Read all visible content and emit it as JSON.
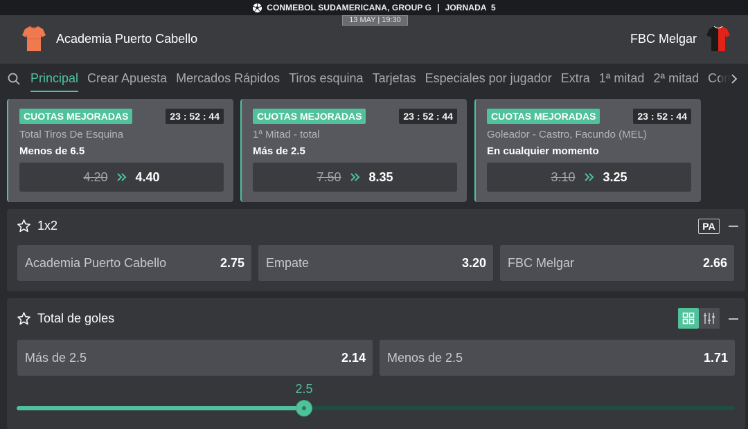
{
  "header": {
    "competition": "CONMEBOL SUDAMERICANA, GROUP G",
    "separator": "|",
    "round": "JORNADA  5",
    "date": "13 MAY | 19:30",
    "home_team": "Academia Puerto Cabello",
    "away_team": "FBC Melgar",
    "icons": {
      "competition": "soccer-ball-icon",
      "home_kit": "shirt-icon",
      "away_kit": "shirt-icon"
    },
    "colors": {
      "home_kit": "#f07a4f",
      "away_kit_red": "#e32219",
      "away_kit_black": "#1a1a1a"
    }
  },
  "tabs": {
    "search_icon": "search-icon",
    "more_icon": "chevron-right-icon",
    "items": [
      {
        "label": "Principal",
        "active": true
      },
      {
        "label": "Crear Apuesta"
      },
      {
        "label": "Mercados Rápidos"
      },
      {
        "label": "Tiros esquina"
      },
      {
        "label": "Tarjetas"
      },
      {
        "label": "Especiales por jugador"
      },
      {
        "label": "Extra"
      },
      {
        "label": "1ª mitad"
      },
      {
        "label": "2ª mitad"
      },
      {
        "label": "Com"
      }
    ]
  },
  "boosts": [
    {
      "badge": "CUOTAS MEJORADAS",
      "timer": "23 : 52 : 44",
      "market": "Total Tiros De Esquina",
      "selection": "Menos de 6.5",
      "old_odd": "4.20",
      "new_odd": "4.40"
    },
    {
      "badge": "CUOTAS MEJORADAS",
      "timer": "23 : 52 : 44",
      "market": "1ª Mitad - total",
      "selection": "Más de 2.5",
      "old_odd": "7.50",
      "new_odd": "8.35"
    },
    {
      "badge": "CUOTAS MEJORADAS",
      "timer": "23 : 52 : 44",
      "market": "Goleador - Castro, Facundo (MEL)",
      "selection": "En cualquier momento",
      "old_odd": "3.10",
      "new_odd": "3.25"
    }
  ],
  "market_1x2": {
    "title": "1x2",
    "badge": "PA",
    "icons": {
      "favorite": "star-icon",
      "collapse": "minus-icon"
    },
    "selections": [
      {
        "label": "Academia Puerto Cabello",
        "odd": "2.75"
      },
      {
        "label": "Empate",
        "odd": "3.20"
      },
      {
        "label": "FBC Melgar",
        "odd": "2.66"
      }
    ]
  },
  "market_goals": {
    "title": "Total de goles",
    "icons": {
      "favorite": "star-icon",
      "grid_view": "grid-icon",
      "slider_view": "sliders-icon",
      "collapse": "minus-icon"
    },
    "selections": [
      {
        "label": "Más de 2.5",
        "odd": "2.14"
      },
      {
        "label": "Menos de 2.5",
        "odd": "1.71"
      }
    ],
    "line_value": "2.5",
    "line_position_fraction": 0.4
  },
  "colors": {
    "accent": "#4fc29b",
    "background": "#2a2b2f",
    "card": "#56585d",
    "panel": "#36373b",
    "selection": "#4c4d52"
  }
}
